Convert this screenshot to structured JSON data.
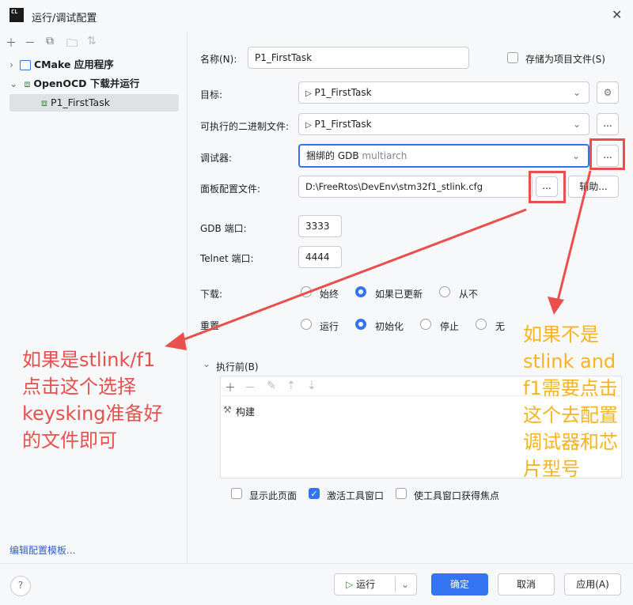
{
  "window": {
    "app_icon_text": "CL",
    "title": "运行/调试配置",
    "close_icon": "close-icon"
  },
  "left_toolbar": [
    "add-icon",
    "remove-icon",
    "copy-icon",
    "folder-icon",
    "sort-icon"
  ],
  "tree": [
    {
      "label": "CMake 应用程序",
      "icon": "cmake-icon"
    },
    {
      "label": "OpenOCD 下载并运行",
      "icon": "chip-icon"
    },
    {
      "label": "P1_FirstTask",
      "icon": "chip-icon"
    }
  ],
  "edit_templates_link": "编辑配置模板...",
  "form": {
    "name_label": "名称(N):",
    "name_value": "P1_FirstTask",
    "store_as_project_label": "存储为项目文件(S)",
    "target_label": "目标:",
    "target_value": "P1_FirstTask",
    "executable_label": "可执行的二进制文件:",
    "executable_value": "P1_FirstTask",
    "debugger_label": "调试器:",
    "debugger_value": "捆绑的 GDB",
    "debugger_hint": "multiarch",
    "board_config_label": "面板配置文件:",
    "board_config_value": "D:\\FreeRtos\\DevEnv\\stm32f1_stlink.cfg",
    "browse_label": "...",
    "assist_label": "辅助...",
    "gdb_port_label": "GDB 端口:",
    "gdb_port_value": "3333",
    "telnet_port_label": "Telnet 端口:",
    "telnet_port_value": "4444",
    "download_label": "下载:",
    "download_options": [
      "始终",
      "如果已更新",
      "从不"
    ],
    "download_selected": 1,
    "reset_label": "重置",
    "reset_options": [
      "运行",
      "初始化",
      "停止",
      "无"
    ],
    "reset_selected": 1,
    "before_launch_label": "执行前(B)",
    "before_launch_item": "构建",
    "show_page_label": "显示此页面",
    "activate_tool_label": "激活工具窗口",
    "focus_tool_label": "使工具窗口获得焦点"
  },
  "annotations": {
    "red_text": [
      "如果是stlink/f1",
      "点击这个选择",
      "keysking准备好",
      "的文件即可"
    ],
    "orange_text": [
      "如果不是",
      "stlink and",
      "f1需要点击",
      "这个去配置",
      "调试器和芯",
      "片型号"
    ],
    "red_color": "#e8504d",
    "orange_color": "#f5b520"
  },
  "footer": {
    "help_icon": "help-icon",
    "run_label": "运行",
    "ok_label": "确定",
    "cancel_label": "取消",
    "apply_label": "应用(A)"
  },
  "colors": {
    "accent": "#3574f0"
  }
}
